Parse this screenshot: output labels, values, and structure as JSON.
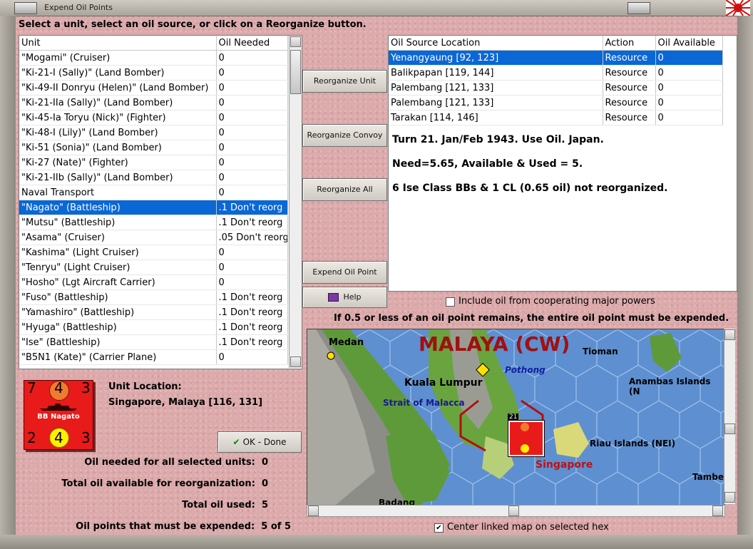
{
  "window": {
    "title": "Expend Oil Points"
  },
  "instruction": "Select a unit, select an oil source, or click on a Reorganize button.",
  "units_table": {
    "headers": [
      "Unit",
      "Oil Needed"
    ],
    "rows": [
      [
        "\"Mogami\" (Cruiser)",
        "0"
      ],
      [
        "\"Ki-21-I (Sally)\" (Land Bomber)",
        "0"
      ],
      [
        "\"Ki-49-II Donryu (Helen)\" (Land Bomber)",
        "0"
      ],
      [
        "\"Ki-21-IIa (Sally)\" (Land Bomber)",
        "0"
      ],
      [
        "\"Ki-45-Ia Toryu (Nick)\" (Fighter)",
        "0"
      ],
      [
        "\"Ki-48-I (Lily)\" (Land Bomber)",
        "0"
      ],
      [
        "\"Ki-51 (Sonia)\" (Land Bomber)",
        "0"
      ],
      [
        "\"Ki-27 (Nate)\" (Fighter)",
        "0"
      ],
      [
        "\"Ki-21-IIb (Sally)\" (Land Bomber)",
        "0"
      ],
      [
        "Naval Transport",
        "0"
      ],
      [
        "\"Nagato\" (Battleship)",
        ".1 Don't reorg"
      ],
      [
        "\"Mutsu\" (Battleship)",
        ".1 Don't reorg"
      ],
      [
        "\"Asama\" (Cruiser)",
        ".05 Don't reorg"
      ],
      [
        "\"Kashima\" (Light Cruiser)",
        "0"
      ],
      [
        "\"Tenryu\" (Light Cruiser)",
        "0"
      ],
      [
        "\"Hosho\" (Lgt Aircraft Carrier)",
        "0"
      ],
      [
        "\"Fuso\" (Battleship)",
        ".1 Don't reorg"
      ],
      [
        "\"Yamashiro\" (Battleship)",
        ".1 Don't reorg"
      ],
      [
        "\"Hyuga\" (Battleship)",
        ".1 Don't reorg"
      ],
      [
        "\"Ise\" (Battleship)",
        ".1 Don't reorg"
      ],
      [
        "\"B5N1 (Kate)\" (Carrier Plane)",
        "0"
      ]
    ],
    "selected_row": 10
  },
  "buttons": {
    "reorganize_unit": "Reorganize Unit",
    "reorganize_convoy": "Reorganize Convoy",
    "reorganize_all": "Reorganize All",
    "expend_oil_point": "Expend Oil Point",
    "help": "Help",
    "ok_done": "OK - Done"
  },
  "oil_sources": {
    "headers": [
      "Oil Source Location",
      "Action",
      "Oil Available"
    ],
    "rows": [
      [
        "Yenangyaung [92, 123]",
        "Resource",
        "0"
      ],
      [
        "Balikpapan [119, 144]",
        "Resource",
        "0"
      ],
      [
        "Palembang [121, 133]",
        "Resource",
        "0"
      ],
      [
        "Palembang [121, 133]",
        "Resource",
        "0"
      ],
      [
        "Tarakan [114, 146]",
        "Resource",
        "0"
      ]
    ],
    "selected_row": 0
  },
  "info": {
    "line1": "Turn 21.  Jan/Feb 1943.  Use Oil.  Japan.",
    "line2": "Need=5.65, Available & Used = 5.",
    "line3": "6 Ise Class BBs & 1 CL (0.65 oil) not reorganized."
  },
  "include_oil_label": "Include oil from cooperating major powers",
  "include_oil_checked": false,
  "rule_text": "If 0.5 or less of an oil point remains, the entire oil point must be expended.",
  "unit_location": {
    "label": "Unit Location:",
    "value": "Singapore, Malaya [116, 131]"
  },
  "counter": {
    "top_left": "7",
    "top_mid": "4",
    "top_right": "3",
    "name": "BB Nagato",
    "bot_left": "2",
    "bot_mid": "4",
    "bot_right": "3"
  },
  "summary": [
    {
      "label": "Oil needed for all selected units:",
      "value": "0"
    },
    {
      "label": "Total oil available for reorganization:",
      "value": "0"
    },
    {
      "label": "Total oil used:",
      "value": "5"
    },
    {
      "label": "Oil points that must be expended:",
      "value": "5 of 5"
    }
  ],
  "map": {
    "region": "MALAYA (CW)",
    "labels": [
      "Medan",
      "Kuala Lumpur",
      "Pothong",
      "Strait of Malacca",
      "Tioman",
      "Anambas Islands (N",
      "Riau Islands (NEI)",
      "Singapore",
      "Tambe",
      "Badang"
    ],
    "stack_count": "21"
  },
  "center_map_label": "Center linked map on selected hex",
  "center_map_checked": true,
  "colors": {
    "selection": "#0a67d6",
    "counter": "#e81a1a",
    "region_label": "#a01010"
  }
}
